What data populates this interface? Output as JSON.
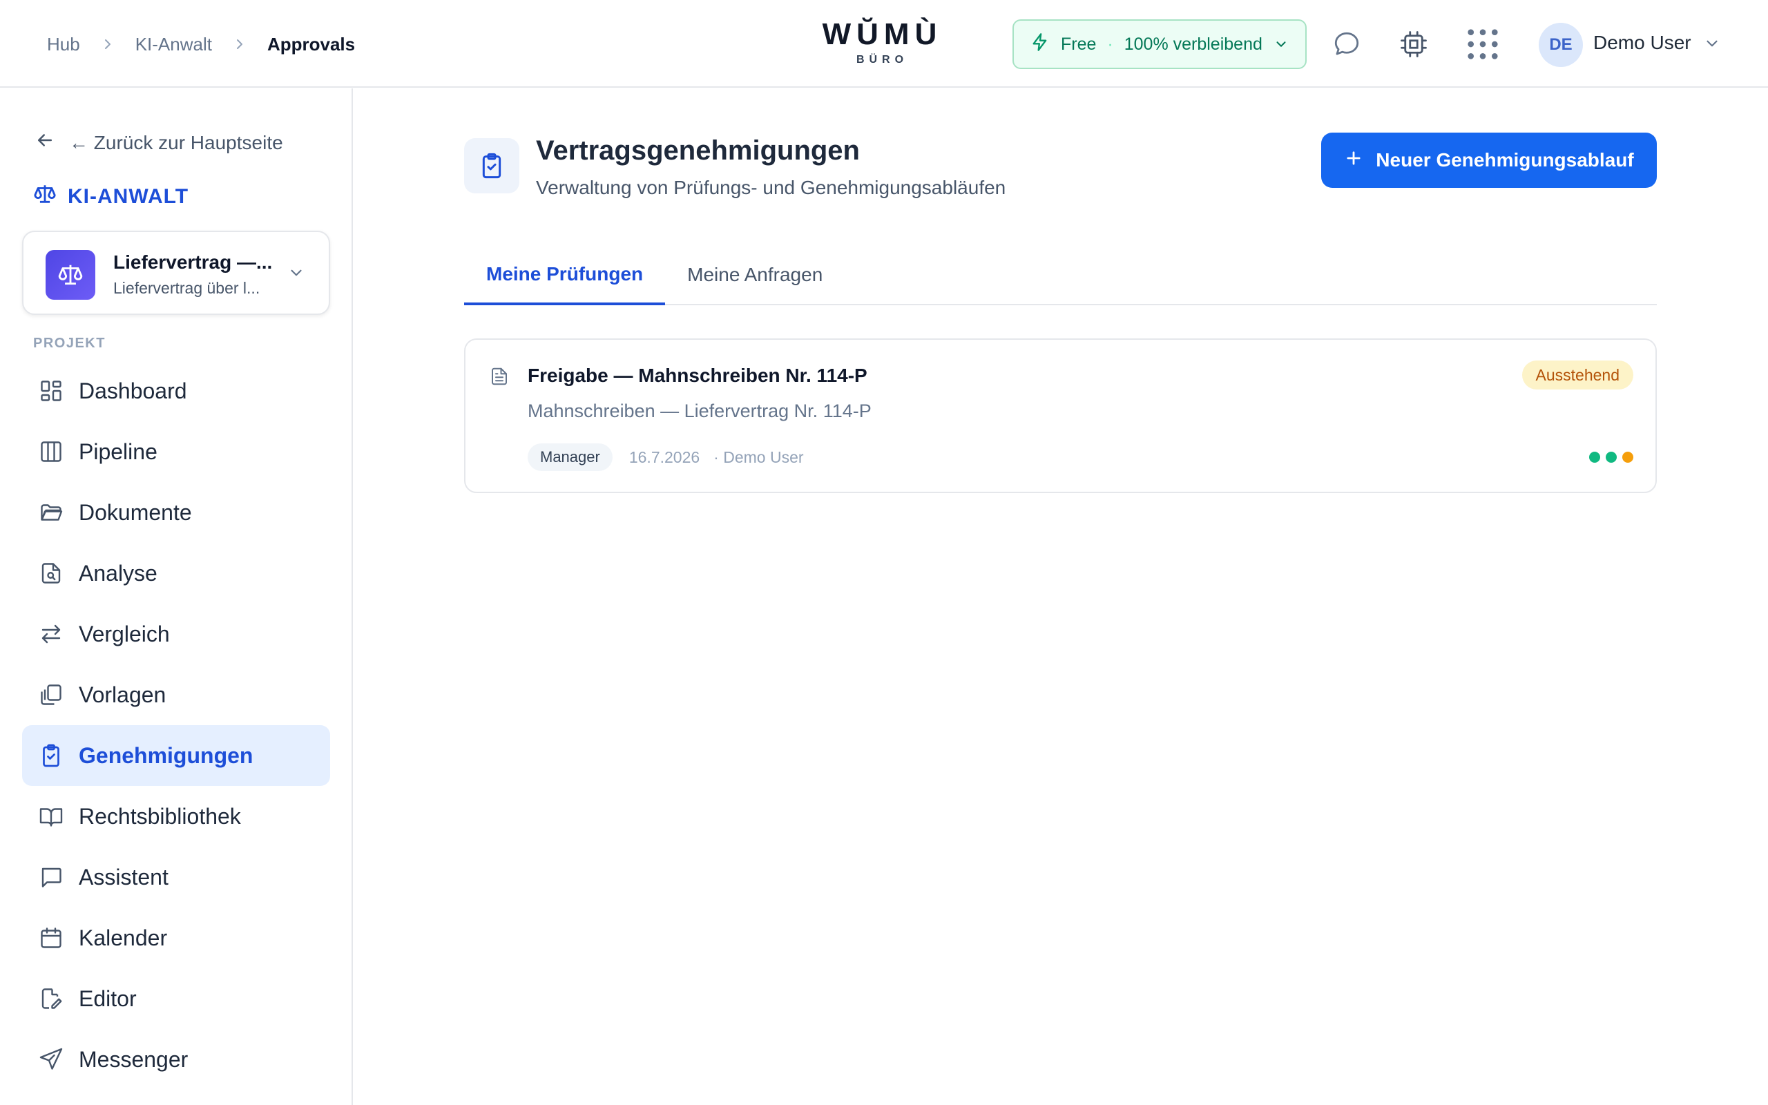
{
  "breadcrumb": [
    "Hub",
    "KI-Anwalt",
    "Approvals"
  ],
  "logo": {
    "word": "WŬMÙ",
    "sub": "BÜRO"
  },
  "plan": {
    "tier": "Free",
    "separator": "·",
    "remaining": "100% verbleibend"
  },
  "user": {
    "initials": "DE",
    "name": "Demo User"
  },
  "sidebar": {
    "back_label": "← Zurück zur Hauptseite",
    "app_title": "KI-ANWALT",
    "project": {
      "title": "Liefervertrag —...",
      "subtitle": "Liefervertrag über l..."
    },
    "section_label": "PROJEKT",
    "items": [
      {
        "label": "Dashboard",
        "icon": "dashboard-icon"
      },
      {
        "label": "Pipeline",
        "icon": "pipeline-icon"
      },
      {
        "label": "Dokumente",
        "icon": "folder-icon"
      },
      {
        "label": "Analyse",
        "icon": "file-search-icon"
      },
      {
        "label": "Vergleich",
        "icon": "compare-icon"
      },
      {
        "label": "Vorlagen",
        "icon": "templates-icon"
      },
      {
        "label": "Genehmigungen",
        "icon": "clipboard-check-icon",
        "active": true
      },
      {
        "label": "Rechtsbibliothek",
        "icon": "book-icon"
      },
      {
        "label": "Assistent",
        "icon": "chat-icon"
      },
      {
        "label": "Kalender",
        "icon": "calendar-icon"
      },
      {
        "label": "Editor",
        "icon": "edit-file-icon"
      },
      {
        "label": "Messenger",
        "icon": "send-icon"
      }
    ]
  },
  "main": {
    "title": "Vertragsgenehmigungen",
    "subtitle": "Verwaltung von Prüfungs- und Genehmigungsabläufen",
    "new_button": "Neuer Genehmigungsablauf",
    "tabs": [
      {
        "label": "Meine Prüfungen",
        "active": true
      },
      {
        "label": "Meine Anfragen",
        "active": false
      }
    ],
    "approvals": [
      {
        "title": "Freigabe — Mahnschreiben Nr. 114-P",
        "subtitle": "Mahnschreiben — Liefervertrag Nr. 114-P",
        "status": "Ausstehend",
        "role": "Manager",
        "date": "16.7.2026",
        "author": "· Demo User",
        "steps": [
          "#10b981",
          "#10b981",
          "#f59e0b"
        ]
      }
    ]
  },
  "colors": {
    "accent": "#1667f0",
    "active_bg": "#e5efff",
    "pending_bg": "#fdf3c8",
    "pending_text": "#b45309"
  }
}
